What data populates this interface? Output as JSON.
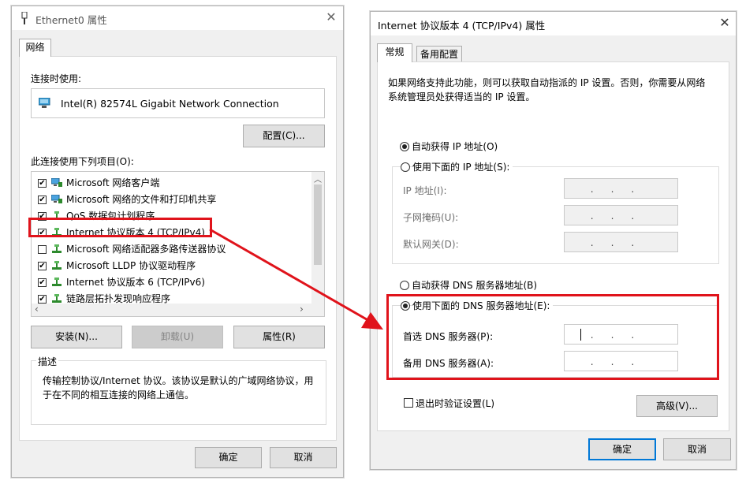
{
  "left_dialog": {
    "title": "Ethernet0 属性",
    "tab": "网络",
    "connect_using_label": "连接时使用:",
    "adapter_name": "Intel(R) 82574L Gigabit Network Connection",
    "configure_button": "配置(C)...",
    "items_label": "此连接使用下列项目(O):",
    "items": [
      {
        "label": "Microsoft 网络客户端",
        "checked": true
      },
      {
        "label": "Microsoft 网络的文件和打印机共享",
        "checked": true
      },
      {
        "label": "QoS 数据包计划程序",
        "checked": true
      },
      {
        "label": "Internet 协议版本 4 (TCP/IPv4)",
        "checked": true
      },
      {
        "label": "Microsoft 网络适配器多路传送器协议",
        "checked": false
      },
      {
        "label": "Microsoft LLDP 协议驱动程序",
        "checked": true
      },
      {
        "label": "Internet 协议版本 6 (TCP/IPv6)",
        "checked": true
      },
      {
        "label": "链路层拓扑发现响应程序",
        "checked": true
      }
    ],
    "install_button": "安装(N)...",
    "uninstall_button": "卸载(U)",
    "properties_button": "属性(R)",
    "description_label": "描述",
    "description_text": "传输控制协议/Internet 协议。该协议是默认的广域网络协议，用于在不同的相互连接的网络上通信。",
    "ok_button": "确定",
    "cancel_button": "取消"
  },
  "right_dialog": {
    "title": "Internet 协议版本 4 (TCP/IPv4) 属性",
    "tabs": [
      "常规",
      "备用配置"
    ],
    "intro_text": "如果网络支持此功能，则可以获取自动指派的 IP 设置。否则，你需要从网络系统管理员处获得适当的 IP 设置。",
    "auto_ip_radio": "自动获得 IP 地址(O)",
    "manual_ip_radio": "使用下面的 IP 地址(S):",
    "ip_address_label": "IP 地址(I):",
    "subnet_label": "子网掩码(U):",
    "gateway_label": "默认网关(D):",
    "auto_dns_radio": "自动获得 DNS 服务器地址(B)",
    "manual_dns_radio": "使用下面的 DNS 服务器地址(E):",
    "preferred_dns_label": "首选 DNS 服务器(P):",
    "alternate_dns_label": "备用 DNS 服务器(A):",
    "validate_checkbox": "退出时验证设置(L)",
    "advanced_button": "高级(V)...",
    "ok_button": "确定",
    "cancel_button": "取消",
    "ip_dots": "...",
    "selected_ip_option": "auto",
    "selected_dns_option": "manual"
  },
  "colors": {
    "highlight": "#e0131b",
    "accent": "#0078d7"
  }
}
